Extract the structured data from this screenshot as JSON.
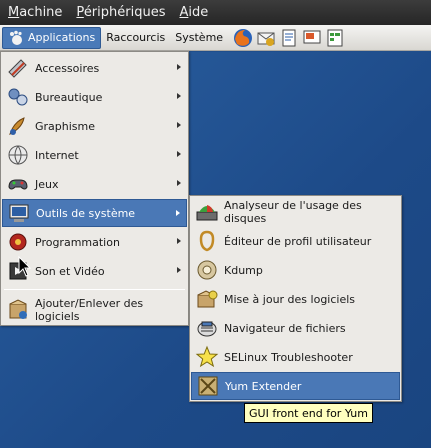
{
  "vm_menubar": {
    "items": [
      {
        "label": "Machine",
        "mnemonic": "M",
        "rest": "achine"
      },
      {
        "label": "Périphériques",
        "mnemonic": "P",
        "rest": "ériphériques"
      },
      {
        "label": "Aide",
        "mnemonic": "A",
        "rest": "ide"
      }
    ]
  },
  "panel": {
    "applications": "Applications",
    "places": "Raccourcis",
    "system": "Système",
    "launchers": [
      "firefox-icon",
      "evolution-icon",
      "writer-icon",
      "impress-icon",
      "calc-icon"
    ]
  },
  "applications_menu": {
    "items": [
      {
        "label": "Accessoires",
        "icon": "accessories-icon",
        "submenu": true
      },
      {
        "label": "Bureautique",
        "icon": "office-icon",
        "submenu": true
      },
      {
        "label": "Graphisme",
        "icon": "graphics-icon",
        "submenu": true
      },
      {
        "label": "Internet",
        "icon": "internet-icon",
        "submenu": true
      },
      {
        "label": "Jeux",
        "icon": "games-icon",
        "submenu": true
      },
      {
        "label": "Outils de système",
        "icon": "system-tools-icon",
        "submenu": true,
        "highlighted": true
      },
      {
        "label": "Programmation",
        "icon": "programming-icon",
        "submenu": true
      },
      {
        "label": "Son et Vidéo",
        "icon": "sound-video-icon",
        "submenu": true
      }
    ],
    "footer_item": {
      "label": "Ajouter/Enlever des logiciels",
      "icon": "package-manager-icon"
    }
  },
  "system_tools_menu": {
    "items": [
      {
        "label": "Analyseur de l'usage des disques",
        "icon": "disk-usage-icon"
      },
      {
        "label": "Éditeur de profil utilisateur",
        "icon": "profile-editor-icon"
      },
      {
        "label": "Kdump",
        "icon": "kdump-icon"
      },
      {
        "label": "Mise à jour des logiciels",
        "icon": "software-update-icon"
      },
      {
        "label": "Navigateur de fichiers",
        "icon": "file-browser-icon"
      },
      {
        "label": "SELinux Troubleshooter",
        "icon": "selinux-star-icon"
      },
      {
        "label": "Yum Extender",
        "icon": "yum-extender-icon",
        "highlighted": true
      }
    ]
  },
  "tooltip": "GUI front end for Yum",
  "colors": {
    "highlight": "#4a78b6",
    "menu_bg": "#eceae6",
    "desktop": "#1f4e8c",
    "tooltip_bg": "#ffffbf"
  }
}
